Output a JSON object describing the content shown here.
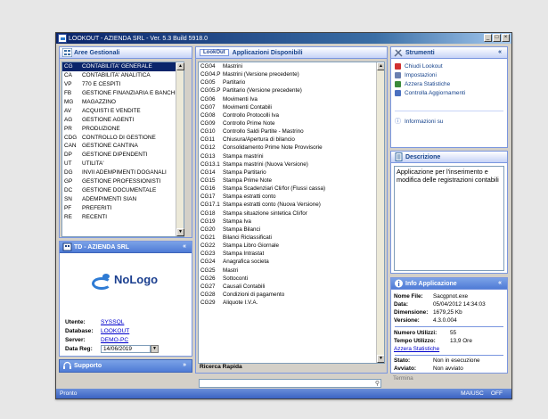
{
  "window": {
    "title": "LOOKOUT - AZIENDA SRL - Ver. 5.3 Build 5918.0"
  },
  "aree": {
    "header": "Aree Gestionali",
    "items": [
      {
        "code": "CG",
        "label": "CONTABILITA' GENERALE",
        "selected": true
      },
      {
        "code": "CA",
        "label": "CONTABILITA' ANALITICA"
      },
      {
        "code": "VP",
        "label": "770 E CESPITI"
      },
      {
        "code": "FB",
        "label": "GESTIONE FINANZIARIA E BANCHE"
      },
      {
        "code": "MG",
        "label": "MAGAZZINO"
      },
      {
        "code": "AV",
        "label": "ACQUISTI E VENDITE"
      },
      {
        "code": "AG",
        "label": "GESTIONE AGENTI"
      },
      {
        "code": "PR",
        "label": "PRODUZIONE"
      },
      {
        "code": "CDG",
        "label": "CONTROLLO DI GESTIONE"
      },
      {
        "code": "CAN",
        "label": "GESTIONE CANTINA"
      },
      {
        "code": "DP",
        "label": "GESTIONE DIPENDENTI"
      },
      {
        "code": "UT",
        "label": "UTILITA'"
      },
      {
        "code": "DG",
        "label": "INVII ADEMPIMENTI DOGANALI"
      },
      {
        "code": "GP",
        "label": "GESTIONE PROFESSIONISTI"
      },
      {
        "code": "DC",
        "label": "GESTIONE DOCUMENTALE"
      },
      {
        "code": "SN",
        "label": "ADEMPIMENTI SIAN"
      },
      {
        "code": "PF",
        "label": "PREFERITI"
      },
      {
        "code": "RE",
        "label": "RECENTI"
      }
    ]
  },
  "company": {
    "header": "TD - AZIENDA SRL",
    "logo_text": "NoLogo",
    "utente_label": "Utente:",
    "utente": "SYSSQL",
    "database_label": "Database:",
    "database": "LOOKOUT",
    "server_label": "Server:",
    "server": "DEMO-PC",
    "datareg_label": "Data Reg:",
    "datareg": "14/06/2019"
  },
  "supporto": {
    "header": "Supporto"
  },
  "apps": {
    "header_brand": "LookOut",
    "header": "Applicazioni Disponibili",
    "items": [
      {
        "code": "CG04",
        "label": "Mastrini"
      },
      {
        "code": "CG04.P",
        "label": "Mastrini (Versione precedente)"
      },
      {
        "code": "CG05",
        "label": "Partitario"
      },
      {
        "code": "CG05.P",
        "label": "Partitario (Versione precedente)"
      },
      {
        "code": "CG06",
        "label": "Movimenti Iva"
      },
      {
        "code": "CG07",
        "label": "Movimenti Contabili"
      },
      {
        "code": "CG08",
        "label": "Controllo Protocolli Iva"
      },
      {
        "code": "CG09",
        "label": "Controllo Prime Note"
      },
      {
        "code": "CG10",
        "label": "Controllo Saldi Partite - Mastrino"
      },
      {
        "code": "CG11",
        "label": "Chiusura/Apertura di bilancio"
      },
      {
        "code": "CG12",
        "label": "Consolidamento Prime Note Provvisorie"
      },
      {
        "code": "CG13",
        "label": "Stampa mastrini"
      },
      {
        "code": "CG13.1",
        "label": "Stampa mastrini (Nuova Versione)"
      },
      {
        "code": "CG14",
        "label": "Stampa Partitario"
      },
      {
        "code": "CG15",
        "label": "Stampa Prime Note"
      },
      {
        "code": "CG16",
        "label": "Stampa Scadenziari Cli/for (Flussi cassa)"
      },
      {
        "code": "CG17",
        "label": "Stampa estratti conto"
      },
      {
        "code": "CG17.1",
        "label": "Stampa estratti conto (Nuova Versione)"
      },
      {
        "code": "CG18",
        "label": "Stampa situazione sintetica Cli/for"
      },
      {
        "code": "CG19",
        "label": "Stampa Iva"
      },
      {
        "code": "CG20",
        "label": "Stampa Bilanci"
      },
      {
        "code": "CG21",
        "label": "Bilanci Riclassificati"
      },
      {
        "code": "CG22",
        "label": "Stampa Libro Giornale"
      },
      {
        "code": "CG23",
        "label": "Stampa Intrastat"
      },
      {
        "code": "CG24",
        "label": "Anagrafica societa"
      },
      {
        "code": "CG25",
        "label": "Mastri"
      },
      {
        "code": "CG26",
        "label": "Sottoconti"
      },
      {
        "code": "CG27",
        "label": "Causali Contabili"
      },
      {
        "code": "CG28",
        "label": "Condizioni di pagamento"
      },
      {
        "code": "CG29",
        "label": "Aliquote I.V.A."
      }
    ],
    "search_label": "Ricerca Rapida",
    "search_value": ""
  },
  "strumenti": {
    "header": "Strumenti",
    "items": [
      {
        "label": "Chiudi Lookout",
        "color": "#d03030"
      },
      {
        "label": "Impostazioni",
        "color": "#6a7fb0"
      },
      {
        "label": "Azzera Statistiche",
        "color": "#3a8a3a"
      },
      {
        "label": "Controlla Aggiornamenti",
        "color": "#4a70c0"
      }
    ],
    "info": "Informazioni su"
  },
  "descrizione": {
    "header": "Descrizione",
    "text": "Applicazione per l'inserimento e modifica delle registrazioni contabili"
  },
  "infoapp": {
    "header": "Info Applicazione",
    "nome_label": "Nome File:",
    "nome": "Sacgpnot.exe",
    "data_label": "Data:",
    "data": "05/04/2012 14:34:03",
    "dim_label": "Dimensione:",
    "dim": "1679,25 Kb",
    "ver_label": "Versione:",
    "ver": "4.3.0.004",
    "num_label": "Numero Utilizzi:",
    "num": "55",
    "tempo_label": "Tempo Utilizzo:",
    "tempo": "13,9 Ore",
    "azzera": "Azzera Statistiche",
    "stato_label": "Stato:",
    "stato": "Non in esecuzione",
    "avviato_label": "Avviato:",
    "avviato": "Non avviato",
    "termina": "Termina"
  },
  "status": {
    "left": "Pronto",
    "right1": "MAIUSC",
    "right2": "OFF"
  }
}
